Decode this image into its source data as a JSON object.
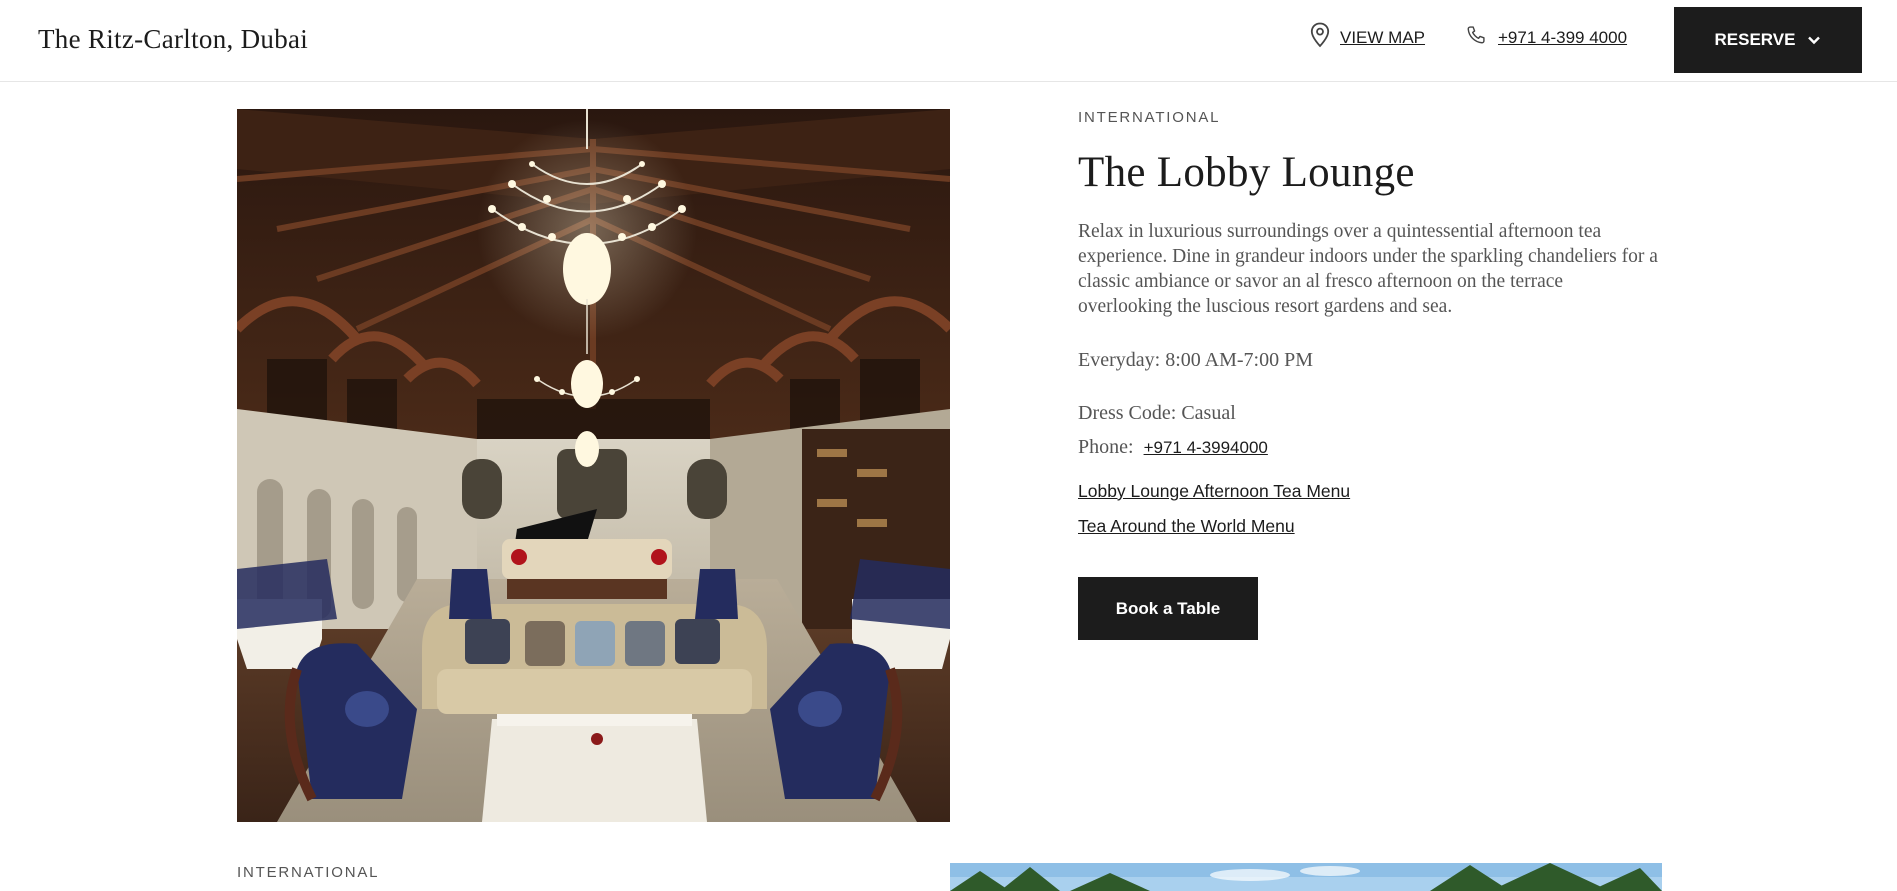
{
  "header": {
    "brand": "The Ritz-Carlton, Dubai",
    "view_map": "VIEW MAP",
    "phone": "+971 4-399 4000",
    "reserve": "RESERVE"
  },
  "restaurant": {
    "category": "INTERNATIONAL",
    "name": "The Lobby Lounge",
    "description": "Relax in luxurious surroundings over a quintessential afternoon tea experience. Dine in grandeur indoors under the sparkling chandeliers for a classic ambiance or savor an al fresco afternoon on the terrace overlooking the luscious resort gardens and sea.",
    "hours": "Everyday:  8:00 AM-7:00 PM",
    "dress_code": "Dress Code:  Casual",
    "phone_label": "Phone:",
    "phone": "+971 4-3994000",
    "menus": [
      "Lobby Lounge Afternoon Tea Menu",
      "Tea Around the World Menu"
    ],
    "book_label": "Book a Table"
  },
  "next_section": {
    "category": "INTERNATIONAL"
  },
  "icons": [
    "map-pin-icon",
    "phone-icon",
    "chevron-down-icon"
  ],
  "colors": {
    "dark": "#1c1c1c",
    "muted_text": "#555555"
  }
}
